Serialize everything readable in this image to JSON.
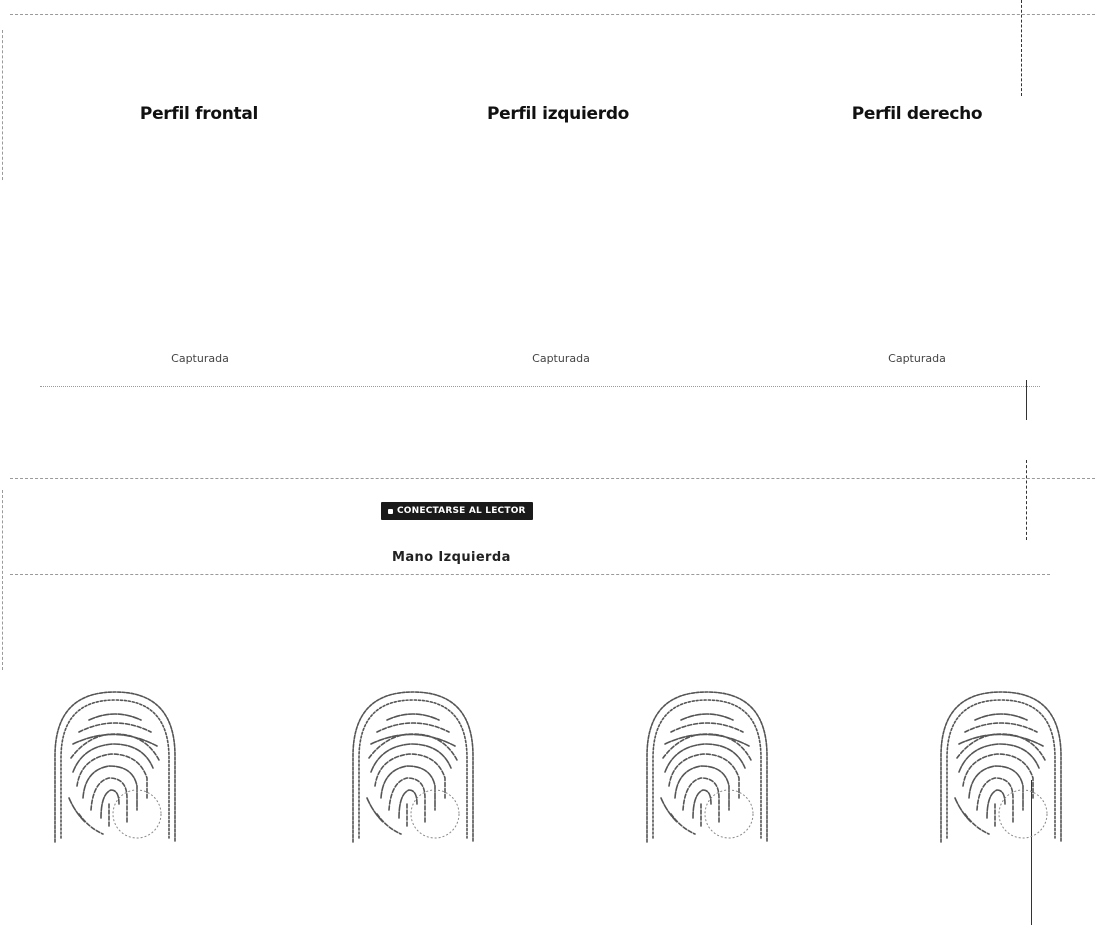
{
  "profiles": [
    {
      "title": "Perfil frontal",
      "status": "Capturada"
    },
    {
      "title": "Perfil izquierdo",
      "status": "Capturada"
    },
    {
      "title": "Perfil derecho",
      "status": "Capturada"
    }
  ],
  "reader": {
    "connect_label": "CONECTARSE AL LECTOR"
  },
  "hand": {
    "title": "Mano Izquierda"
  },
  "fingerprints": [
    {
      "icon": "fingerprint-icon"
    },
    {
      "icon": "fingerprint-icon"
    },
    {
      "icon": "fingerprint-icon"
    },
    {
      "icon": "fingerprint-icon"
    }
  ],
  "colors": {
    "button_bg": "#1a1a1a",
    "line": "#333333"
  }
}
